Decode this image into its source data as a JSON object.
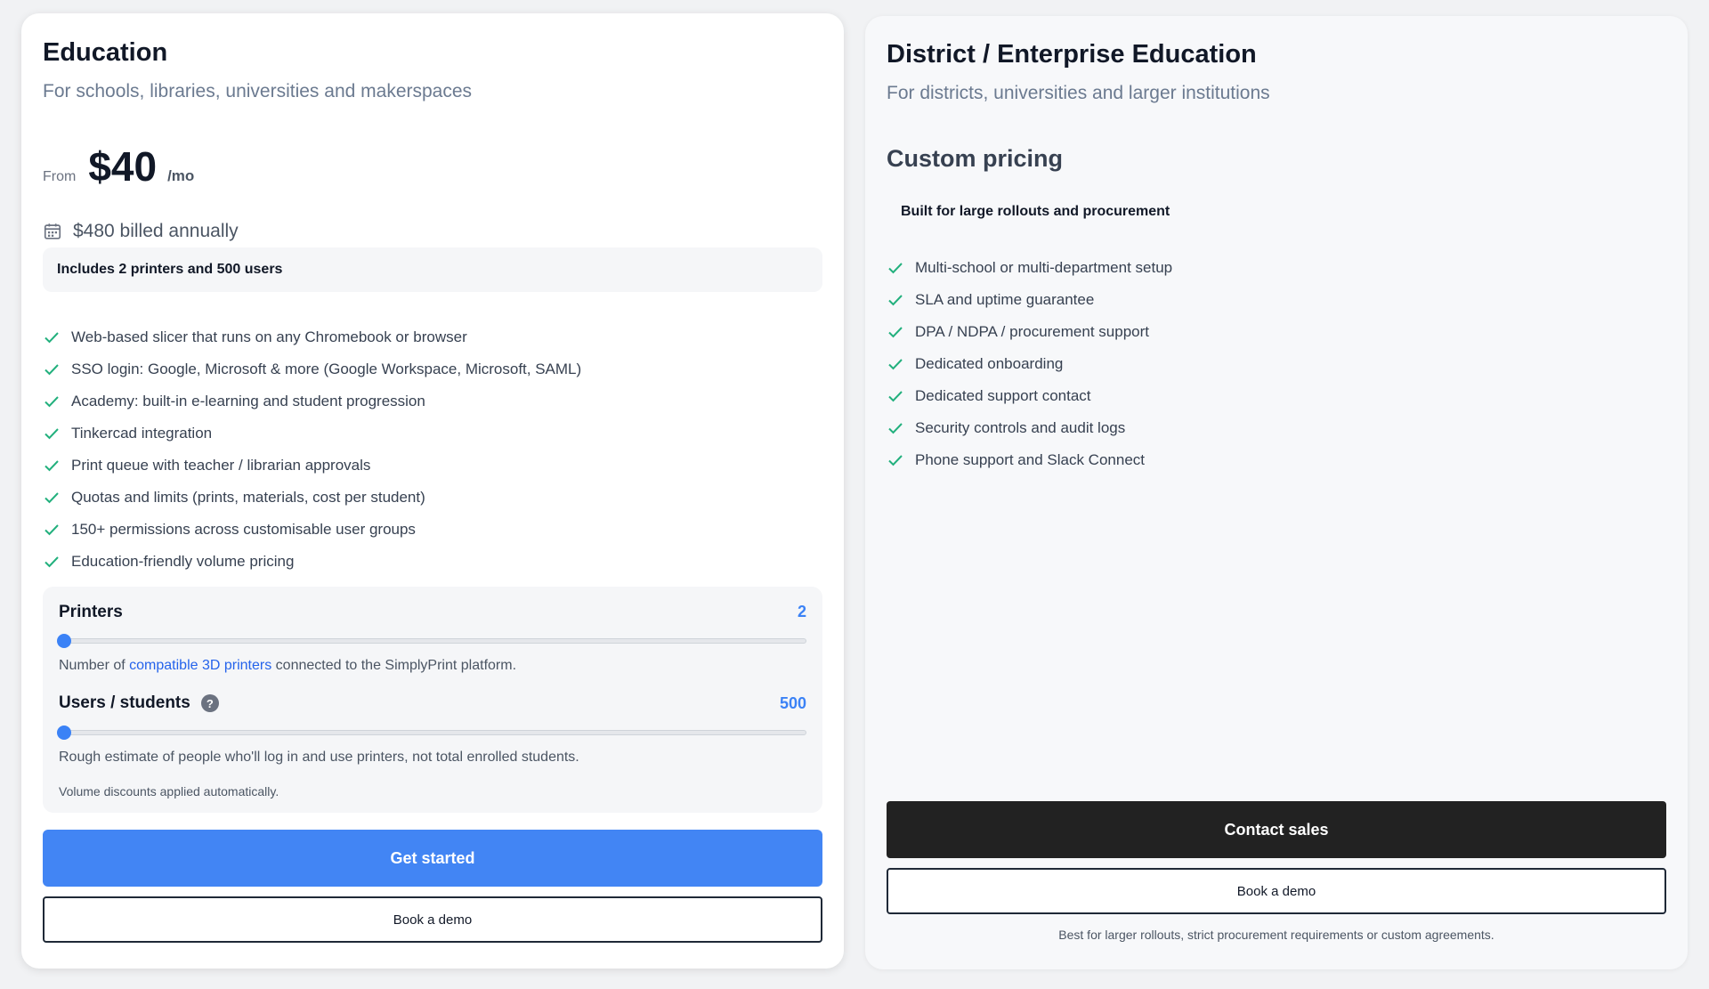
{
  "education": {
    "title": "Education",
    "subtitle": "For schools, libraries, universities and makerspaces",
    "price_from": "From",
    "price_amount": "$40",
    "price_period": "/mo",
    "billed": "$480 billed annually",
    "includes": "Includes 2 printers and 500 users",
    "features": [
      "Web-based slicer that runs on any Chromebook or browser",
      "SSO login: Google, Microsoft & more (Google Workspace, Microsoft, SAML)",
      "Academy: built-in e-learning and student progression",
      "Tinkercad integration",
      "Print queue with teacher / librarian approvals",
      "Quotas and limits (prints, materials, cost per student)",
      "150+ permissions across customisable user groups",
      "Education-friendly volume pricing"
    ],
    "printers": {
      "label": "Printers",
      "value": "2",
      "slider_fraction": 0.0,
      "help_prefix": "Number of ",
      "help_link": "compatible 3D printers",
      "help_suffix": " connected to the SimplyPrint platform."
    },
    "users": {
      "label": "Users / students",
      "value": "500",
      "slider_fraction": 0.0,
      "help": "Rough estimate of people who'll log in and use printers, not total enrolled students."
    },
    "volume_note": "Volume discounts applied automatically.",
    "get_started": "Get started",
    "book_demo": "Book a demo"
  },
  "enterprise": {
    "title": "District / Enterprise Education",
    "subtitle": "For districts, universities and larger institutions",
    "custom_pricing": "Custom pricing",
    "built_for": "Built for large rollouts and procurement",
    "features": [
      "Multi-school or multi-department setup",
      "SLA and uptime guarantee",
      "DPA / NDPA / procurement support",
      "Dedicated onboarding",
      "Dedicated support contact",
      "Security controls and audit logs",
      "Phone support and Slack Connect"
    ],
    "contact_sales": "Contact sales",
    "book_demo": "Book a demo",
    "footnote": "Best for larger rollouts, strict procurement requirements or custom agreements."
  },
  "colors": {
    "accent_blue": "#4285f4",
    "check_green": "#22b07d",
    "dark_button": "#222222"
  },
  "icons": {
    "check": "check-icon",
    "calendar": "calendar-icon",
    "help": "question-circle-icon"
  }
}
